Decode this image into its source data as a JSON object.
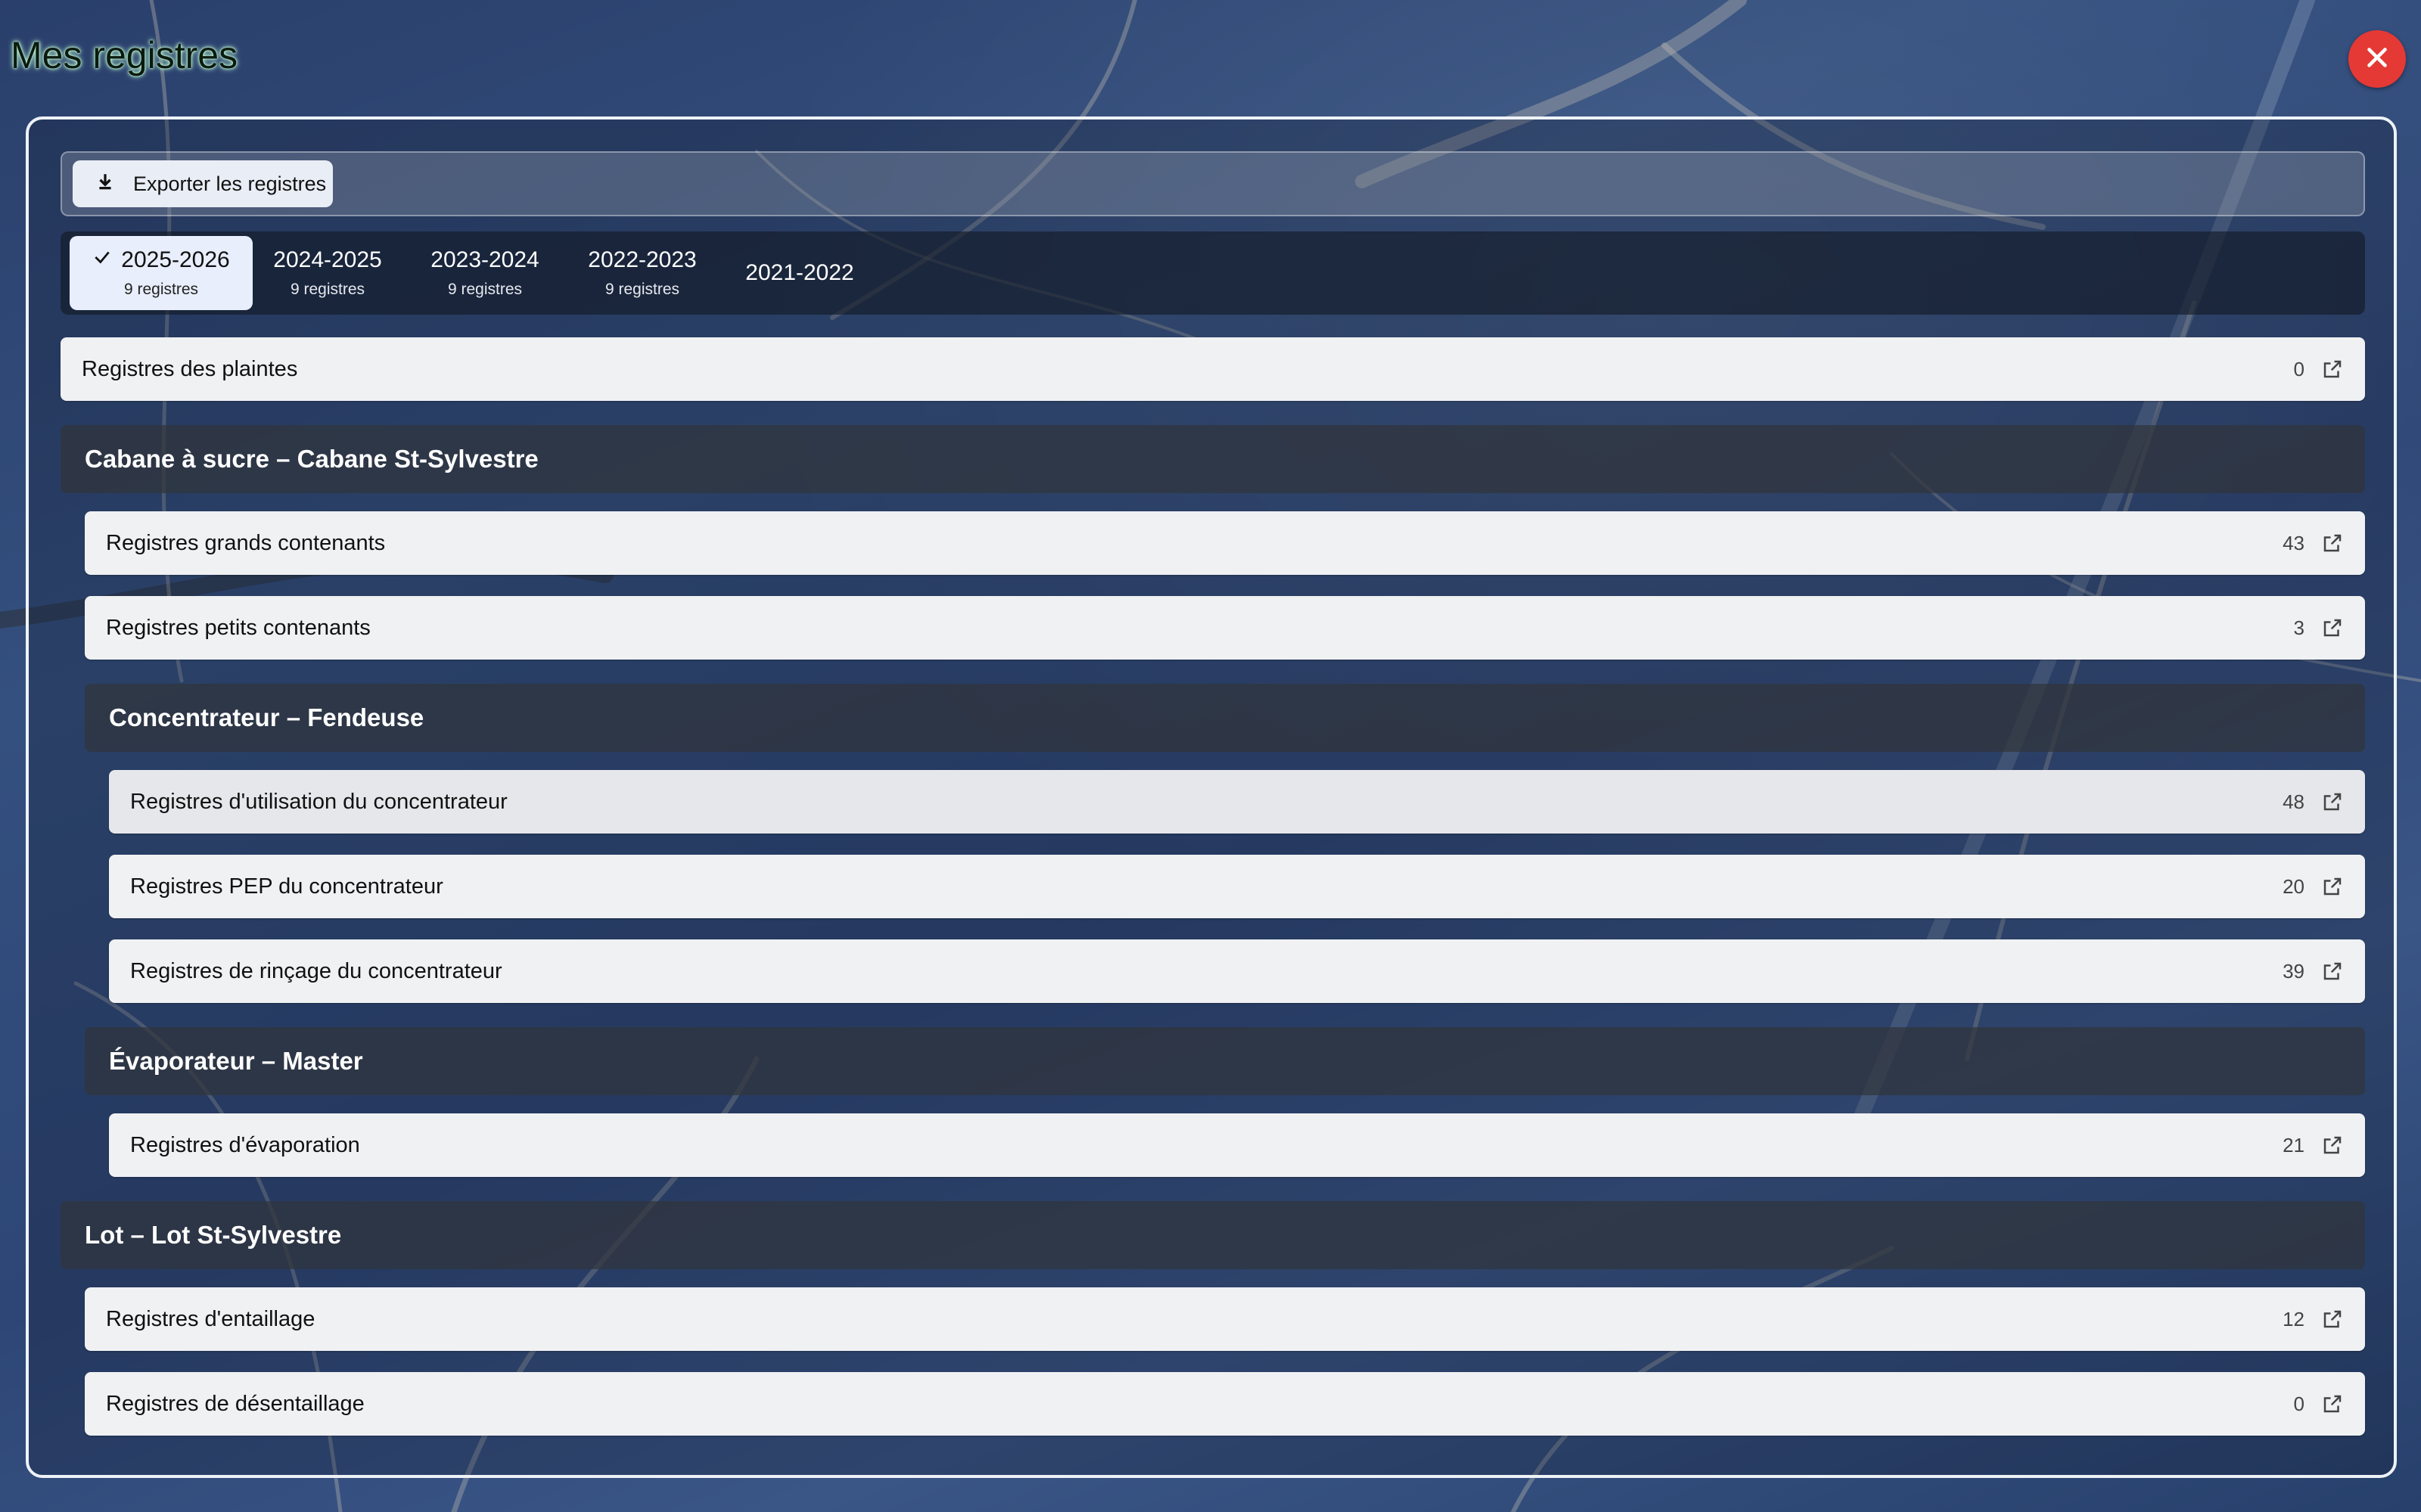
{
  "app": {
    "title": "Mes registres"
  },
  "toolbar": {
    "export_label": "Exporter les registres"
  },
  "tabs": [
    {
      "label": "2025-2026",
      "count": "9 registres",
      "active": true
    },
    {
      "label": "2024-2025",
      "count": "9 registres",
      "active": false
    },
    {
      "label": "2023-2024",
      "count": "9 registres",
      "active": false
    },
    {
      "label": "2022-2023",
      "count": "9 registres",
      "active": false
    },
    {
      "label": "2021-2022",
      "count": "",
      "active": false
    }
  ],
  "top_row": {
    "label": "Registres des plaintes",
    "count": "0"
  },
  "sections": {
    "cabane": {
      "title": "Cabane à sucre – Cabane St-Sylvestre",
      "rows": [
        {
          "label": "Registres grands contenants",
          "count": "43"
        },
        {
          "label": "Registres petits contenants",
          "count": "3"
        }
      ]
    },
    "concentrateur": {
      "title": "Concentrateur – Fendeuse",
      "rows": [
        {
          "label": "Registres d'utilisation du concentrateur",
          "count": "48"
        },
        {
          "label": "Registres PEP du concentrateur",
          "count": "20"
        },
        {
          "label": "Registres de rinçage du concentrateur",
          "count": "39"
        }
      ]
    },
    "evaporateur": {
      "title": "Évaporateur – Master",
      "rows": [
        {
          "label": "Registres d'évaporation",
          "count": "21"
        }
      ]
    },
    "lot": {
      "title": "Lot – Lot St-Sylvestre",
      "rows": [
        {
          "label": "Registres d'entaillage",
          "count": "12"
        },
        {
          "label": "Registres de désentaillage",
          "count": "0"
        }
      ]
    }
  },
  "icons": {
    "close": "close-icon",
    "export": "download-icon",
    "check": "check-icon",
    "open": "open-in-new-icon"
  },
  "colors": {
    "close_button": "#e53935",
    "active_tab": "#e8eefb",
    "row_bg": "#f0f1f3",
    "section_bg": "#30343c",
    "title_glow": "#b9f5d0"
  }
}
